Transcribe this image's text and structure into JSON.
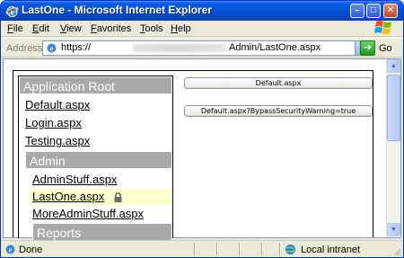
{
  "window": {
    "title": "LastOne - Microsoft Internet Explorer",
    "minimize_symbol": "–",
    "maximize_symbol": "□",
    "close_symbol": "✕"
  },
  "menubar": {
    "items": [
      {
        "hotkey": "F",
        "rest": "ile"
      },
      {
        "hotkey": "E",
        "rest": "dit"
      },
      {
        "hotkey": "V",
        "rest": "iew"
      },
      {
        "hotkey": "F",
        "rest": "avorites",
        "pre": ""
      },
      {
        "hotkey": "T",
        "rest": "ools"
      },
      {
        "hotkey": "H",
        "rest": "elp"
      }
    ]
  },
  "address": {
    "label": "Address",
    "url_prefix": "https://",
    "url_suffix": "Admin/LastOne.aspx",
    "go_label": "Go",
    "go_symbol": "➔"
  },
  "sitemenu": {
    "root_header": "Application Root",
    "root_items": [
      "Default.aspx",
      "Login.aspx",
      "Testing.aspx"
    ],
    "admin_header": "Admin",
    "admin_items": [
      "AdminStuff.aspx",
      "LastOne.aspx",
      "MoreAdminStuff.aspx"
    ],
    "selected_item": "LastOne.aspx",
    "reports_header": "Reports"
  },
  "buttons": {
    "default": "Default.aspx",
    "bypass": "Default.aspx?BypassSecurityWarning=true"
  },
  "status": {
    "text": "Done",
    "zone": "Local intranet"
  },
  "colors": {
    "menu_header_bg": "#a9a9a9",
    "selected_bg": "#ffffcc",
    "titlebar": "#0454d6"
  }
}
